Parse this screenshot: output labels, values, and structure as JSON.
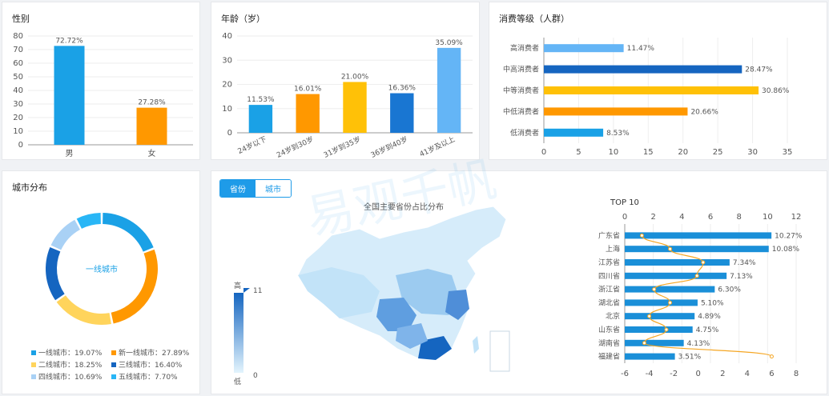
{
  "gender": {
    "title": "性别",
    "chart_data": {
      "type": "bar",
      "categories": [
        "男",
        "女"
      ],
      "values": [
        72.72,
        27.28
      ],
      "labels": [
        "72.72%",
        "27.28%"
      ],
      "ylim": [
        0,
        80
      ],
      "yticks": [
        0,
        10,
        20,
        30,
        40,
        50,
        60,
        70,
        80
      ],
      "colors": [
        "#1aa1e6",
        "#ff9800"
      ]
    }
  },
  "age": {
    "title": "年龄（岁）",
    "chart_data": {
      "type": "bar",
      "categories": [
        "24岁以下",
        "24岁到30岁",
        "31岁到35岁",
        "36岁到40岁",
        "41岁及以上"
      ],
      "values": [
        11.53,
        16.01,
        21.0,
        16.36,
        35.09
      ],
      "labels": [
        "11.53%",
        "16.01%",
        "21.00%",
        "16.36%",
        "35.09%"
      ],
      "ylim": [
        0,
        40
      ],
      "yticks": [
        0,
        10,
        20,
        30,
        40
      ],
      "colors": [
        "#1aa1e6",
        "#ff9800",
        "#ffc107",
        "#1976d2",
        "#64b5f6"
      ]
    }
  },
  "consumption": {
    "title": "消费等级（人群）",
    "chart_data": {
      "type": "bar",
      "orientation": "horizontal",
      "categories": [
        "高消费者",
        "中高消费者",
        "中等消费者",
        "中低消费者",
        "低消费者"
      ],
      "values": [
        11.47,
        28.47,
        30.86,
        20.66,
        8.53
      ],
      "labels": [
        "11.47%",
        "28.47%",
        "30.86%",
        "20.66%",
        "8.53%"
      ],
      "xlim": [
        0,
        35
      ],
      "xticks": [
        0,
        5,
        10,
        15,
        20,
        25,
        30,
        35
      ],
      "colors": [
        "#64b5f6",
        "#1565c0",
        "#ffc107",
        "#ff9800",
        "#1aa1e6"
      ]
    }
  },
  "city": {
    "title": "城市分布",
    "center_label": "一线城市",
    "chart_data": {
      "type": "pie",
      "style": "donut",
      "categories": [
        "一线城市",
        "新一线城市",
        "二线城市",
        "三线城市",
        "四线城市",
        "五线城市"
      ],
      "values": [
        19.07,
        27.89,
        18.25,
        16.4,
        10.69,
        7.7
      ],
      "legend": [
        "一线城市：19.07%",
        "新一线城市：27.89%",
        "二线城市：18.25%",
        "三线城市：16.40%",
        "四线城市：10.69%",
        "五线城市：7.70%"
      ],
      "colors": [
        "#1aa1e6",
        "#ff9800",
        "#ffd45c",
        "#1565c0",
        "#a9d1f5",
        "#29b6f6"
      ]
    }
  },
  "map": {
    "tabs": [
      "省份",
      "城市"
    ],
    "active_tab": "省份",
    "title": "全国主要省份占比分布",
    "legend_high": "高",
    "legend_low": "低",
    "legend_max": "11",
    "legend_min": "0"
  },
  "top10": {
    "title": "TOP 10",
    "chart_data": {
      "type": "bar",
      "orientation": "horizontal",
      "categories": [
        "广东省",
        "上海",
        "江苏省",
        "四川省",
        "浙江省",
        "湖北省",
        "北京",
        "山东省",
        "湖南省",
        "福建省"
      ],
      "values": [
        10.27,
        10.08,
        7.34,
        7.13,
        6.3,
        5.1,
        4.89,
        4.75,
        4.13,
        3.51
      ],
      "labels": [
        "10.27%",
        "10.08%",
        "7.34%",
        "7.13%",
        "6.30%",
        "5.10%",
        "4.89%",
        "4.75%",
        "4.13%",
        "3.51%"
      ],
      "xlim_top": [
        0,
        12
      ],
      "xticks_top": [
        0,
        2,
        4,
        6,
        8,
        10,
        12
      ],
      "xlim_bottom": [
        -6,
        8
      ],
      "xticks_bottom": [
        -6,
        -4,
        -2,
        0,
        2,
        4,
        6,
        8
      ],
      "curve_x": [
        -4.6,
        -2.3,
        0.4,
        -0.1,
        -3.6,
        -2.3,
        -4.0,
        -2.6,
        -4.4,
        6.0
      ],
      "bar_color": "#1a8fd8",
      "curve_color": "#f5a623"
    }
  },
  "watermark": "易观千帆"
}
